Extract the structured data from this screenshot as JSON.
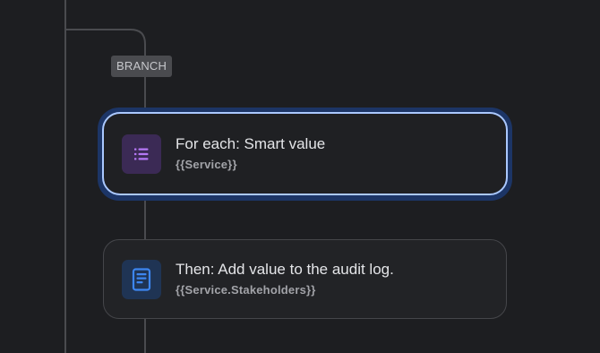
{
  "branch": {
    "label": "BRANCH"
  },
  "nodes": [
    {
      "title": "For each: Smart value",
      "subtitle": "{{Service}}",
      "icon": "list-icon",
      "icon_color": "#b578f5",
      "tile_color": "#3b2a55",
      "selected": true
    },
    {
      "title": "Then: Add value to the audit log.",
      "subtitle": "{{Service.Stakeholders}}",
      "icon": "document-icon",
      "icon_color": "#3d86f0",
      "tile_color": "#1f3454",
      "selected": false
    }
  ],
  "colors": {
    "background": "#1d1e21",
    "connector": "#4a4b4f",
    "selection_ring": "#aac8ff",
    "selection_glow": "#1c3566"
  }
}
